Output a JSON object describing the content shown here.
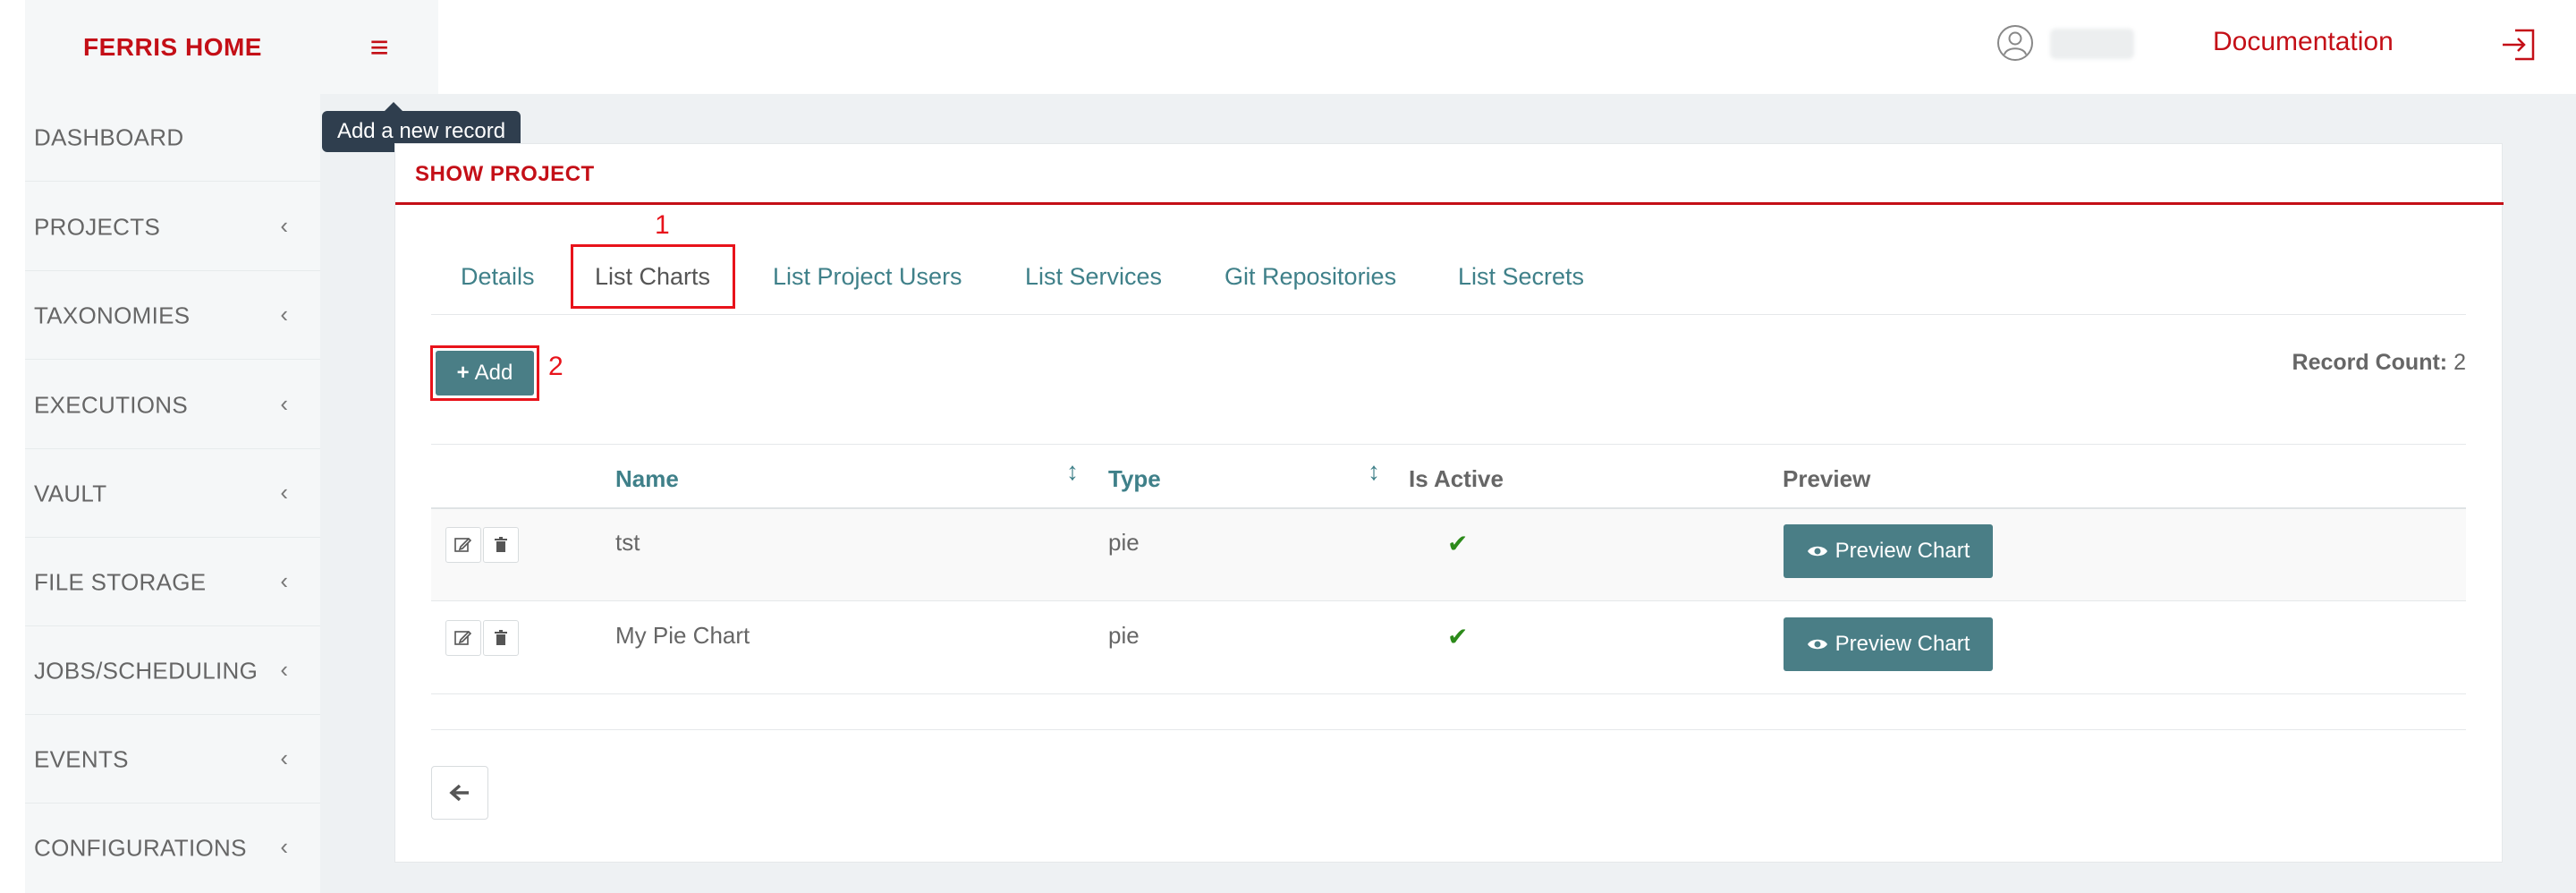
{
  "sidebar": {
    "brand": "FERRIS HOME",
    "items": [
      {
        "label": "DASHBOARD",
        "chevron": ""
      },
      {
        "label": "PROJECTS",
        "chevron": "‹"
      },
      {
        "label": "TAXONOMIES",
        "chevron": "‹"
      },
      {
        "label": "EXECUTIONS",
        "chevron": "‹"
      },
      {
        "label": "VAULT",
        "chevron": "‹"
      },
      {
        "label": "FILE STORAGE",
        "chevron": "‹"
      },
      {
        "label": "JOBS/SCHEDULING",
        "chevron": "‹"
      },
      {
        "label": "EVENTS",
        "chevron": "‹"
      },
      {
        "label": "CONFIGURATIONS",
        "chevron": "‹"
      }
    ]
  },
  "header": {
    "menu_icon": "≡",
    "tooltip": "Add a new record",
    "documentation": "Documentation"
  },
  "panel": {
    "title": "SHOW PROJECT",
    "tabs": [
      "Details",
      "List Charts",
      "List Project Users",
      "List Services",
      "Git Repositories",
      "List Secrets"
    ],
    "active_tab": "List Charts",
    "markers": [
      "1",
      "2"
    ],
    "add_label": "Add",
    "record_count_label": "Record Count:",
    "record_count_value": "2"
  },
  "table": {
    "columns": [
      "Name",
      "Type",
      "Is Active",
      "Preview"
    ],
    "rows": [
      {
        "name": "tst",
        "type": "pie",
        "active": "✔",
        "preview": "Preview Chart"
      },
      {
        "name": "My Pie Chart",
        "type": "pie",
        "active": "✔",
        "preview": "Preview Chart"
      }
    ]
  },
  "icons": {
    "sort": "↕",
    "back": "🡐"
  },
  "colors": {
    "brand_red": "#c40f17",
    "teal": "#4a7e86",
    "annotation_red": "#e8131b",
    "check_green": "#2c8a1a"
  }
}
